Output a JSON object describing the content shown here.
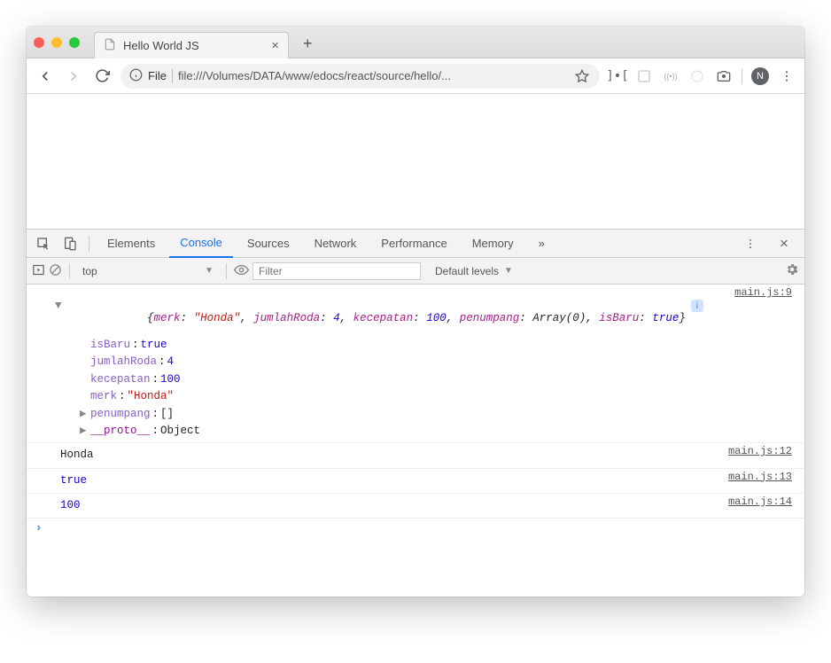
{
  "browser": {
    "tab_title": "Hello World JS",
    "close_icon": "×",
    "newtab_icon": "+",
    "url_scheme": "File",
    "url_path": "file:///Volumes/DATA/www/edocs/react/source/hello/...",
    "avatar_letter": "N"
  },
  "devtools": {
    "tabs": {
      "elements": "Elements",
      "console": "Console",
      "sources": "Sources",
      "network": "Network",
      "performance": "Performance",
      "memory": "Memory",
      "more": "»"
    },
    "context": "top",
    "filter_placeholder": "Filter",
    "levels": "Default levels"
  },
  "console": {
    "src_file": "main.js",
    "obj_summary": {
      "src_line": "9",
      "merk": "\"Honda\"",
      "jumlahRoda": "4",
      "kecepatan": "100",
      "penumpang_type": "Array(0)",
      "isBaru": "true"
    },
    "obj_props": {
      "isBaru": "true",
      "jumlahRoda": "4",
      "kecepatan": "100",
      "merk": "\"Honda\"",
      "penumpang": "[]",
      "proto_key": "__proto__",
      "proto_val": "Object"
    },
    "logs": [
      {
        "value": "Honda",
        "line": "12",
        "color": "plain"
      },
      {
        "value": "true",
        "line": "13",
        "color": "bool"
      },
      {
        "value": "100",
        "line": "14",
        "color": "num"
      }
    ],
    "prompt": "›"
  }
}
